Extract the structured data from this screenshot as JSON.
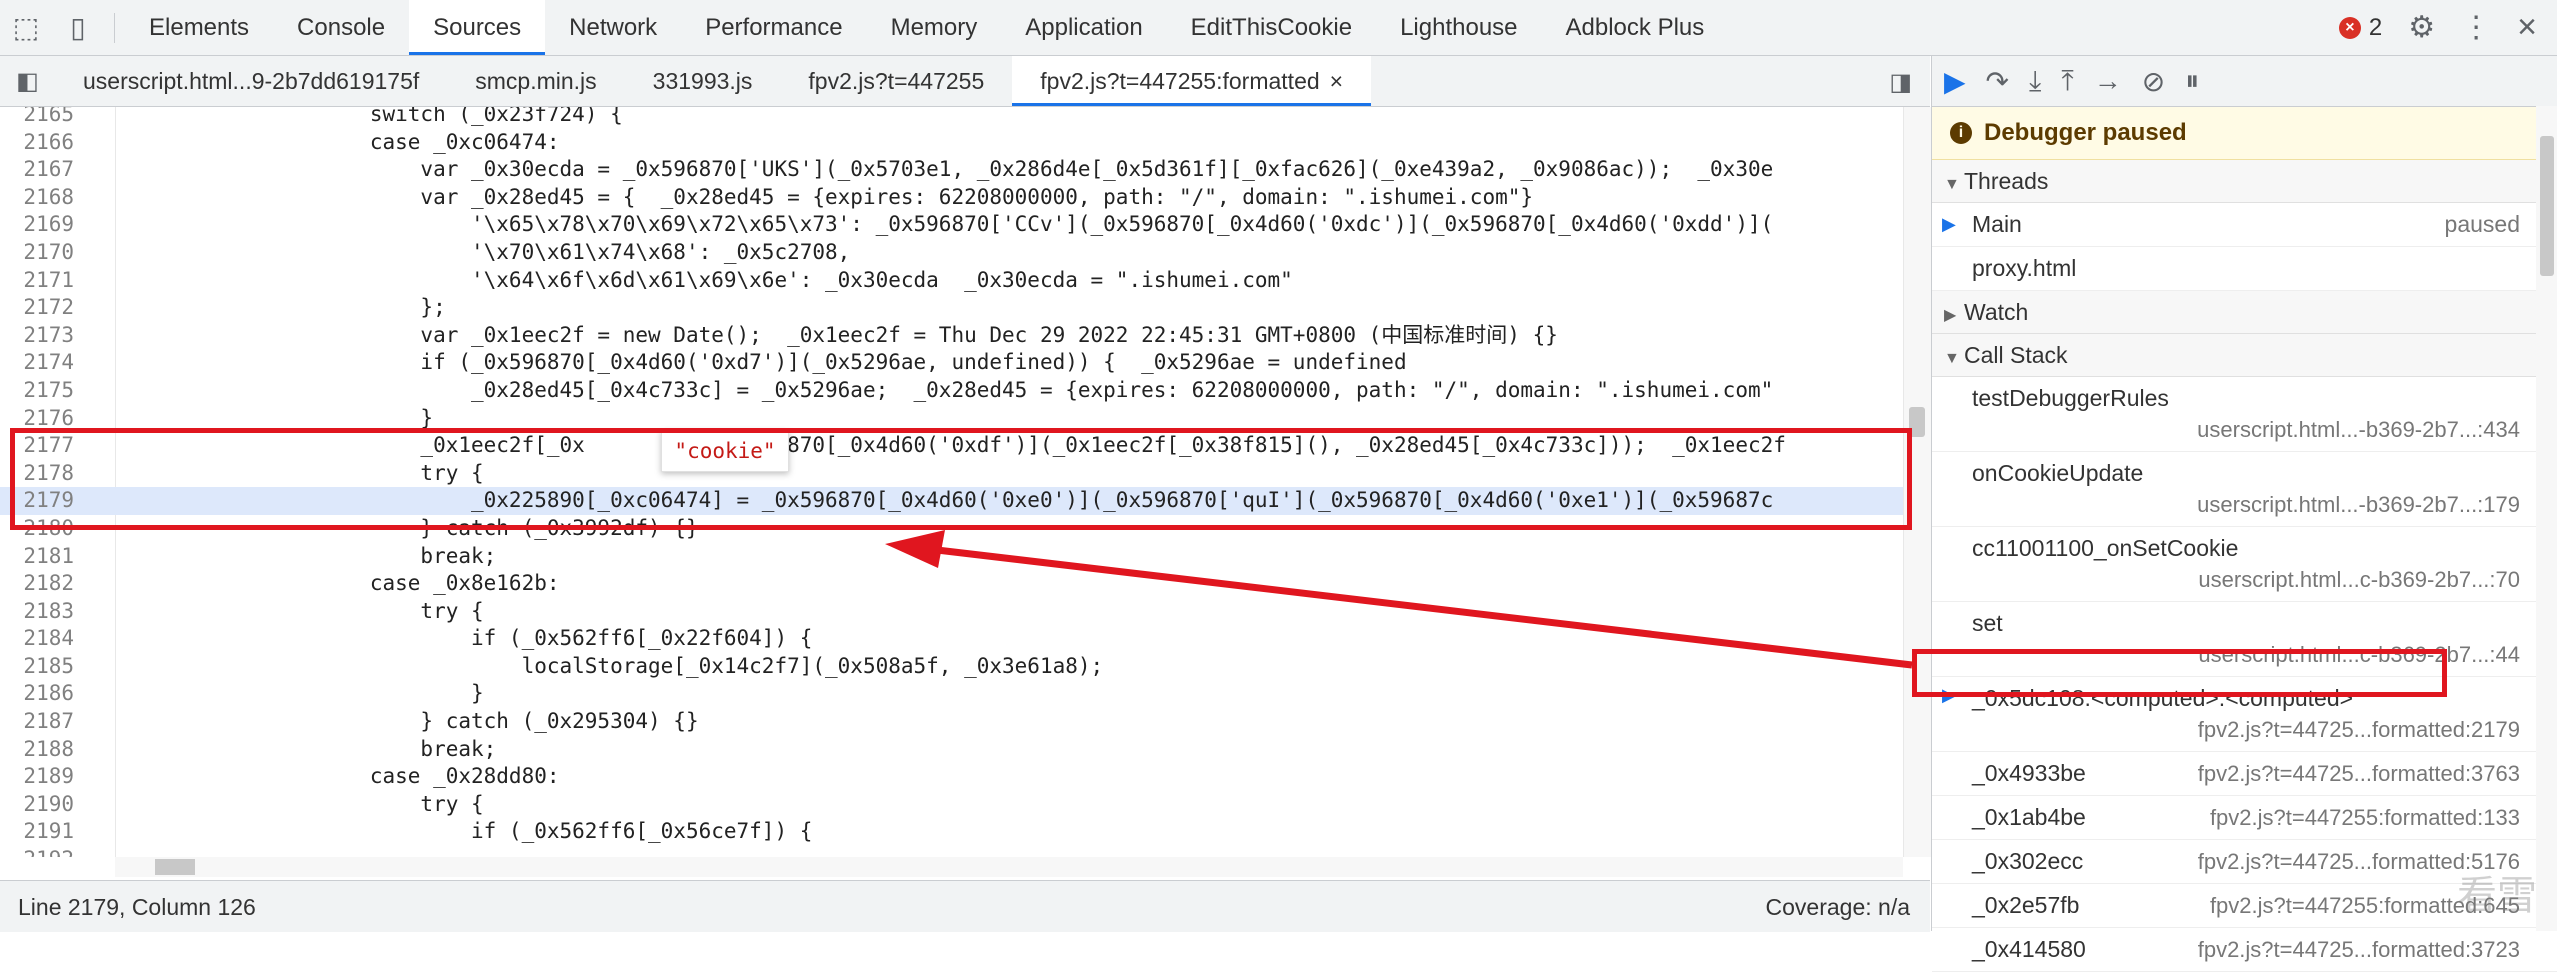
{
  "top": {
    "tabs": [
      "Elements",
      "Console",
      "Sources",
      "Network",
      "Performance",
      "Memory",
      "Application",
      "EditThisCookie",
      "Lighthouse",
      "Adblock Plus"
    ],
    "active_tab": "Sources",
    "error_count": "2"
  },
  "file_tabs": [
    "userscript.html...9-2b7dd619175f",
    "smcp.min.js",
    "331993.js",
    "fpv2.js?t=447255",
    "fpv2.js?t=447255:formatted"
  ],
  "editor": {
    "lines": [
      {
        "n": "2165",
        "code": "                    switch (_0x23f724) {"
      },
      {
        "n": "2166",
        "code": "                    case _0xc06474:"
      },
      {
        "n": "2167",
        "code": "                        var _0x30ecda = _0x596870['UKS'](_0x5703e1, _0x286d4e[_0x5d361f][_0xfac626](_0xe439a2, _0x9086ac));  _0x30e"
      },
      {
        "n": "2168",
        "code": "                        var _0x28ed45 = {  _0x28ed45 = {expires: 62208000000, path: \"/\", domain: \".ishumei.com\"}"
      },
      {
        "n": "2169",
        "code": "                            '\\x65\\x78\\x70\\x69\\x72\\x65\\x73': _0x596870['CCv'](_0x596870[_0x4d60('0xdc')](_0x596870[_0x4d60('0xdd')]("
      },
      {
        "n": "2170",
        "code": "                            '\\x70\\x61\\x74\\x68': _0x5c2708,"
      },
      {
        "n": "2171",
        "code": "                            '\\x64\\x6f\\x6d\\x61\\x69\\x6e': _0x30ecda  _0x30ecda = \".ishumei.com\""
      },
      {
        "n": "2172",
        "code": "                        };"
      },
      {
        "n": "2173",
        "code": "                        var _0x1eec2f = new Date();  _0x1eec2f = Thu Dec 29 2022 22:45:31 GMT+0800 (中国标准时间) {}"
      },
      {
        "n": "2174",
        "code": "                        if (_0x596870[_0x4d60('0xd7')](_0x5296ae, undefined)) {  _0x5296ae = undefined"
      },
      {
        "n": "2175",
        "code": "                            _0x28ed45[_0x4c733c] = _0x5296ae;  _0x28ed45 = {expires: 62208000000, path: \"/\", domain: \".ishumei.com\""
      },
      {
        "n": "2176",
        "code": "                        }"
      },
      {
        "n": "2177",
        "code": "                        _0x1eec2f[_0x           0x596870[_0x4d60('0xdf')](_0x1eec2f[_0x38f815](), _0x28ed45[_0x4c733c]));  _0x1eec2f"
      },
      {
        "n": "2178",
        "code": "                        try {"
      },
      {
        "n": "2179",
        "code": "                            _0x225890[_0xc06474] = _0x596870[_0x4d60('0xe0')](_0x596870['quI'](_0x596870[_0x4d60('0xe1')](_0x59687c"
      },
      {
        "n": "2180",
        "code": "                        } catch (_0x3992df) {}"
      },
      {
        "n": "2181",
        "code": "                        break;"
      },
      {
        "n": "2182",
        "code": "                    case _0x8e162b:"
      },
      {
        "n": "2183",
        "code": "                        try {"
      },
      {
        "n": "2184",
        "code": "                            if (_0x562ff6[_0x22f604]) {"
      },
      {
        "n": "2185",
        "code": "                                localStorage[_0x14c2f7](_0x508a5f, _0x3e61a8);"
      },
      {
        "n": "2186",
        "code": "                            }"
      },
      {
        "n": "2187",
        "code": "                        } catch (_0x295304) {}"
      },
      {
        "n": "2188",
        "code": "                        break;"
      },
      {
        "n": "2189",
        "code": "                    case _0x28dd80:"
      },
      {
        "n": "2190",
        "code": "                        try {"
      },
      {
        "n": "2191",
        "code": "                            if (_0x562ff6[_0x56ce7f]) {"
      },
      {
        "n": "2192",
        "code": "                                "
      }
    ],
    "highlight_line": "2179",
    "tooltip": "\"cookie\""
  },
  "status": {
    "position": "Line 2179, Column 126",
    "coverage": "Coverage: n/a"
  },
  "debugger": {
    "paused_label": "Debugger paused",
    "threads_label": "Threads",
    "threads": [
      {
        "name": "Main",
        "state": "paused"
      },
      {
        "name": "proxy.html",
        "state": ""
      }
    ],
    "watch_label": "Watch",
    "callstack_label": "Call Stack",
    "frames": [
      {
        "fn": "testDebuggerRules",
        "loc": "userscript.html...-b369-2b7...:434"
      },
      {
        "fn": "onCookieUpdate",
        "loc": "userscript.html...-b369-2b7...:179"
      },
      {
        "fn": "cc11001100_onSetCookie",
        "loc": "userscript.html...c-b369-2b7...:70"
      },
      {
        "fn": "set",
        "loc": "userscript.html...c-b369-2b7...:44"
      },
      {
        "fn": "_0x5dc108.<computed>.<computed>",
        "loc": "fpv2.js?t=44725...formatted:2179"
      },
      {
        "fn": "_0x4933be",
        "loc": "fpv2.js?t=44725...formatted:3763"
      },
      {
        "fn": "_0x1ab4be",
        "loc": "fpv2.js?t=447255:formatted:133"
      },
      {
        "fn": "_0x302ecc",
        "loc": "fpv2.js?t=44725...formatted:5176"
      },
      {
        "fn": "_0x2e57fb",
        "loc": "fpv2.js?t=447255:formatted:645"
      },
      {
        "fn": "_0x414580",
        "loc": "fpv2.js?t=44725...formatted:3723"
      }
    ]
  },
  "watermark": "看雪"
}
